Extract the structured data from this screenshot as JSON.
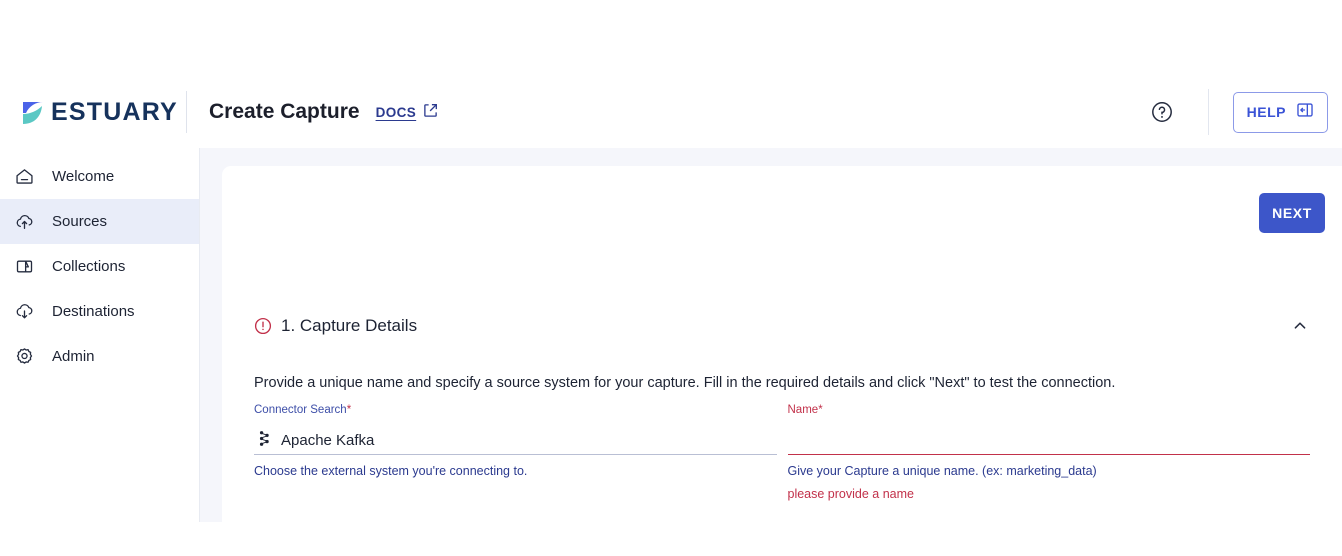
{
  "brand": {
    "name": "ESTUARY",
    "logo_icon": "estuary-leaf-logo"
  },
  "header": {
    "title": "Create Capture",
    "docs_label": "DOCS",
    "docs_icon": "external-link-icon",
    "help_circle_icon": "question-circle-icon",
    "help_button_label": "HELP",
    "help_button_icon": "panel-open-icon"
  },
  "sidebar": {
    "items": [
      {
        "label": "Welcome",
        "icon": "home-icon",
        "active": false
      },
      {
        "label": "Sources",
        "icon": "cloud-upload-icon",
        "active": true
      },
      {
        "label": "Collections",
        "icon": "collections-icon",
        "active": false
      },
      {
        "label": "Destinations",
        "icon": "cloud-download-icon",
        "active": false
      },
      {
        "label": "Admin",
        "icon": "gear-icon",
        "active": false
      }
    ]
  },
  "main": {
    "next_label": "NEXT",
    "section": {
      "status_icon": "error-circle-icon",
      "title": "1. Capture Details",
      "collapse_icon": "chevron-up-icon",
      "description": "Provide a unique name and specify a source system for your capture. Fill in the required details and click \"Next\" to test the connection."
    },
    "connector_search": {
      "label": "Connector Search",
      "required_marker": "*",
      "value": "Apache Kafka",
      "icon": "apache-kafka-icon",
      "helper": "Choose the external system you're connecting to."
    },
    "name_field": {
      "label": "Name",
      "required_marker": "*",
      "value": "",
      "placeholder": "",
      "helper": "Give your Capture a unique name. (ex: marketing_data)",
      "error": "please provide a name"
    }
  },
  "colors": {
    "accent_blue": "#3d56c9",
    "error_red": "#c2314a",
    "link_blue": "#2b3a8f",
    "content_bg": "#f5f6fb",
    "active_nav_bg": "#e9edf9"
  }
}
